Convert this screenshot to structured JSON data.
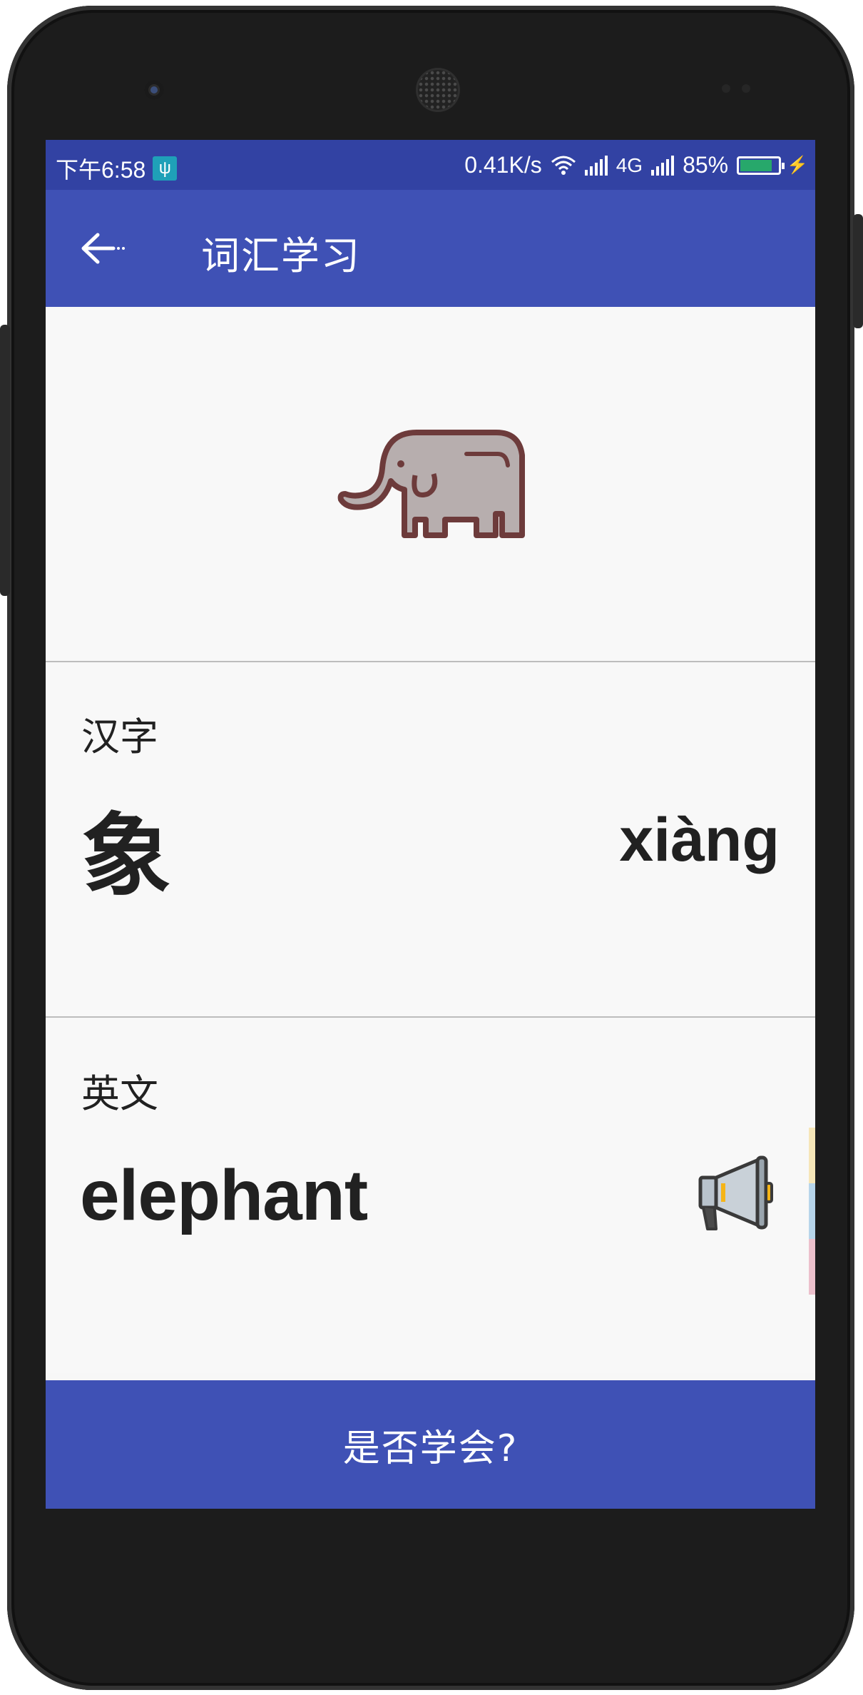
{
  "status_bar": {
    "time": "下午6:58",
    "net_speed": "0.41K/s",
    "network_type": "4G",
    "battery": "85%",
    "battery_level": 0.85
  },
  "app_bar": {
    "title": "词汇学习",
    "back_icon": "arrow-left-icon"
  },
  "image": {
    "icon": "elephant-icon"
  },
  "hanzi": {
    "label": "汉字",
    "character": "象",
    "pinyin": "xiàng"
  },
  "english": {
    "label": "英文",
    "word": "elephant",
    "icon": "megaphone-icon"
  },
  "bottom_button": {
    "label": "是否学会?"
  },
  "colors": {
    "status_bar": "#3242a3",
    "primary": "#3f51b5",
    "background": "#f8f8f8",
    "text": "#212121"
  }
}
